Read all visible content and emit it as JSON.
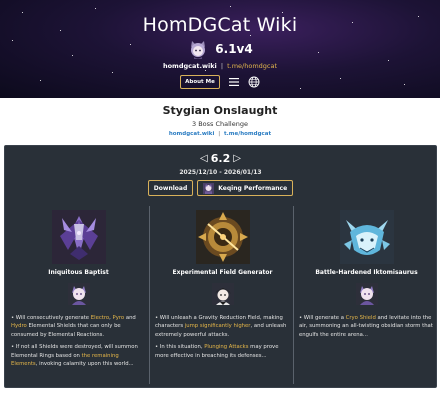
{
  "header": {
    "site_title": "HomDGCat Wiki",
    "version": "6.1v4",
    "site_link": "homdgcat.wiki",
    "separator": "|",
    "telegram_link": "t.me/homdgcat",
    "about_label": "About Me",
    "icons": [
      "mascot-icon",
      "menu-icon",
      "globe-icon"
    ]
  },
  "page": {
    "title": "Stygian Onslaught",
    "subtitle": "3 Boss Challenge",
    "site_link": "homdgcat.wiki",
    "separator": "|",
    "telegram_link": "t.me/homdgcat"
  },
  "panel": {
    "prev_arrow": "◁",
    "version": "6.2",
    "next_arrow": "▷",
    "date_range": "2025/12/10 - 2026/01/13",
    "download_label": "Download",
    "performance_label": "Keqing Performance"
  },
  "bosses": [
    {
      "name": "Iniquitous Baptist",
      "desc": [
        [
          {
            "t": "• Will consecutively generate "
          },
          {
            "t": "Electro",
            "hl": true
          },
          {
            "t": ", "
          },
          {
            "t": "Pyro",
            "hl": true
          },
          {
            "t": " and "
          },
          {
            "t": "Hydro",
            "hl": true
          },
          {
            "t": " Elemental Shields that can only be consumed by Elemental Reactions."
          }
        ],
        [
          {
            "t": "• If not all Shields were destroyed, will summon Elemental Rings based on "
          },
          {
            "t": "the remaining Elements",
            "hl": true
          },
          {
            "t": ", invoking calamity upon this world..."
          }
        ]
      ]
    },
    {
      "name": "Experimental Field Generator",
      "desc": [
        [
          {
            "t": "• Will unleash a Gravity Reduction Field, making characters "
          },
          {
            "t": "jump significantly higher",
            "hl": true
          },
          {
            "t": ", and unleash extremely powerful attacks."
          }
        ],
        [
          {
            "t": "• In this situation, "
          },
          {
            "t": "Plunging Attacks",
            "hl": true
          },
          {
            "t": " may prove more effective in breaching its defenses..."
          }
        ]
      ]
    },
    {
      "name": "Battle-Hardened Iktomisaurus",
      "desc": [
        [
          {
            "t": "• Will generate a "
          },
          {
            "t": "Cryo Shield",
            "hl": true
          },
          {
            "t": " and levitate into the air, summoning an all-twisting obsidian storm that engulfs the entire arena..."
          }
        ]
      ]
    }
  ],
  "colors": {
    "panel_bg": "#293038",
    "accent_gold": "#e7b84a",
    "link_blue": "#2a7cc2"
  }
}
